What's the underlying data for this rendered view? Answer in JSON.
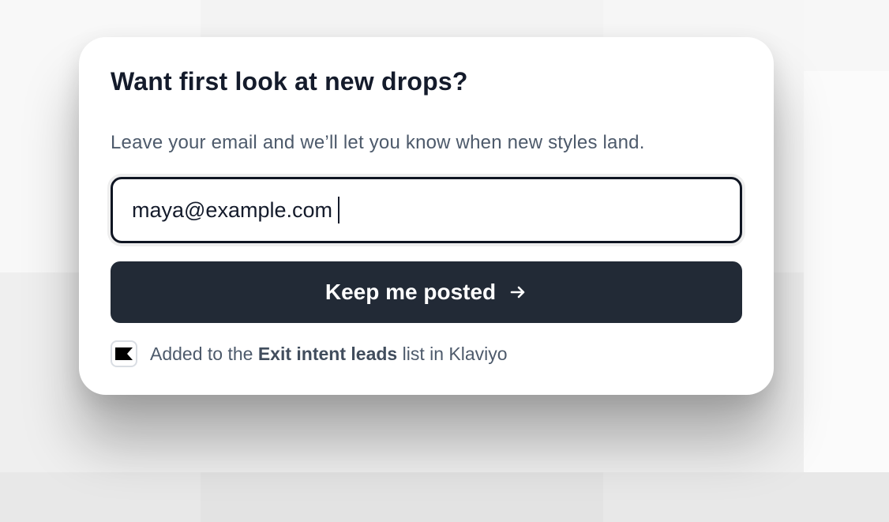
{
  "modal": {
    "title": "Want first look at new drops?",
    "subtitle": "Leave your email and we’ll let you know when new styles land."
  },
  "email_field": {
    "value": "maya@example.com"
  },
  "submit_button": {
    "label": "Keep me posted",
    "icon": "arrow-right-icon"
  },
  "list_note": {
    "icon": "klaviyo-flag-icon",
    "prefix": "Added to the",
    "list_name": "Exit intent leads",
    "suffix": "list in Klaviyo"
  },
  "colors": {
    "button_bg": "#222a36",
    "title": "#141b2b",
    "muted_text": "#4d5a6b"
  }
}
